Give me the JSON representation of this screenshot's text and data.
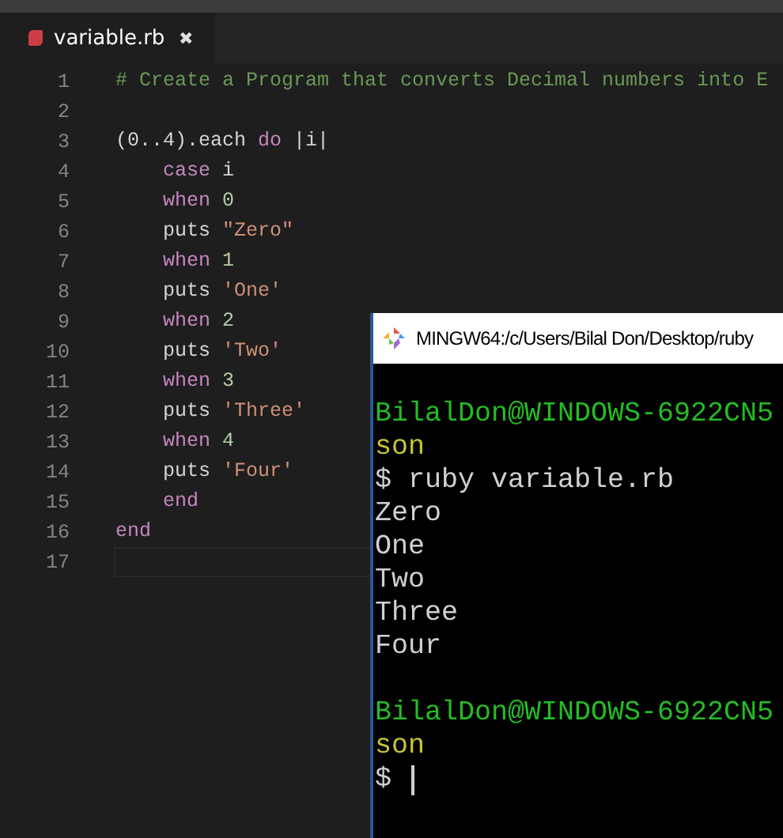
{
  "editor": {
    "tabs": [
      {
        "label": "variable.rb",
        "selected": true,
        "close": "✖"
      }
    ],
    "lines": [
      {
        "number": "1",
        "tokens": [
          {
            "kind": "comment",
            "text": "# Create a Program that converts Decimal numbers into E"
          }
        ]
      },
      {
        "number": "2"
      },
      {
        "number": "3",
        "tokens": [
          {
            "kind": "plain",
            "text": "(0..4).each "
          },
          {
            "kind": "keyword",
            "text": "do"
          },
          {
            "kind": "plain",
            "text": " |i|"
          }
        ]
      },
      {
        "number": "4",
        "tokens": [
          {
            "kind": "keyword",
            "text": "    case"
          },
          {
            "kind": "plain",
            "text": " i"
          }
        ]
      },
      {
        "number": "5",
        "tokens": [
          {
            "kind": "keyword",
            "text": "    when"
          },
          {
            "kind": "number",
            "text": " 0"
          }
        ]
      },
      {
        "number": "6",
        "tokens": [
          {
            "kind": "plain",
            "text": "    puts "
          },
          {
            "kind": "string",
            "text": "\"Zero\""
          }
        ]
      },
      {
        "number": "7",
        "tokens": [
          {
            "kind": "keyword",
            "text": "    when"
          },
          {
            "kind": "number",
            "text": " 1"
          }
        ]
      },
      {
        "number": "8",
        "tokens": [
          {
            "kind": "plain",
            "text": "    puts "
          },
          {
            "kind": "string",
            "text": "'One'"
          }
        ]
      },
      {
        "number": "9",
        "tokens": [
          {
            "kind": "keyword",
            "text": "    when"
          },
          {
            "kind": "number",
            "text": " 2"
          }
        ]
      },
      {
        "number": "10",
        "tokens": [
          {
            "kind": "plain",
            "text": "    puts "
          },
          {
            "kind": "string",
            "text": "'Two'"
          }
        ]
      },
      {
        "number": "11",
        "tokens": [
          {
            "kind": "keyword",
            "text": "    when"
          },
          {
            "kind": "number",
            "text": " 3"
          }
        ]
      },
      {
        "number": "12",
        "tokens": [
          {
            "kind": "plain",
            "text": "    puts "
          },
          {
            "kind": "string",
            "text": "'Three'"
          }
        ]
      },
      {
        "number": "13",
        "tokens": [
          {
            "kind": "keyword",
            "text": "    when"
          },
          {
            "kind": "number",
            "text": " 4"
          }
        ]
      },
      {
        "number": "14",
        "tokens": [
          {
            "kind": "plain",
            "text": "    puts "
          },
          {
            "kind": "string",
            "text": "'Four'"
          }
        ]
      },
      {
        "number": "15",
        "tokens": [
          {
            "kind": "keyword",
            "text": "    end"
          }
        ]
      },
      {
        "number": "16",
        "tokens": [
          {
            "kind": "keyword",
            "text": "end"
          }
        ]
      },
      {
        "number": "17",
        "current": true
      }
    ]
  },
  "terminal": {
    "title": "MINGW64:/c/Users/Bilal Don/Desktop/ruby",
    "lines": [
      {
        "kind": "blank"
      },
      {
        "kind": "user",
        "text": "BilalDon@WINDOWS-6922CN5"
      },
      {
        "kind": "path",
        "text": "son"
      },
      {
        "kind": "command",
        "text": "$ ruby variable.rb"
      },
      {
        "kind": "output",
        "text": "Zero"
      },
      {
        "kind": "output",
        "text": "One"
      },
      {
        "kind": "output",
        "text": "Two"
      },
      {
        "kind": "output",
        "text": "Three"
      },
      {
        "kind": "output",
        "text": "Four"
      },
      {
        "kind": "blank"
      },
      {
        "kind": "user",
        "text": "BilalDon@WINDOWS-6922CN5"
      },
      {
        "kind": "path",
        "text": "son"
      },
      {
        "kind": "prompt",
        "text": "$"
      }
    ]
  }
}
